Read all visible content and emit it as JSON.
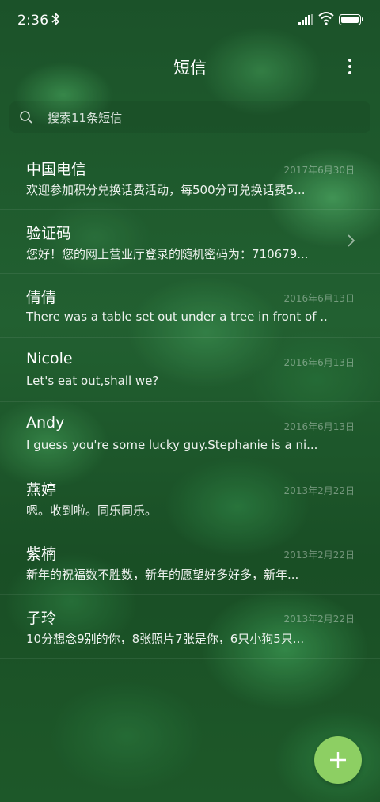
{
  "status": {
    "time": "2:36",
    "bluetooth_icon": "bluetooth-icon",
    "signal_icon": "signal-icon",
    "wifi_icon": "wifi-icon",
    "battery_icon": "battery-icon"
  },
  "header": {
    "title": "短信",
    "more_icon": "more-vert-icon"
  },
  "search": {
    "placeholder": "搜索11条短信",
    "icon": "search-icon"
  },
  "messages": [
    {
      "name": "中国电信",
      "date": "2017年6月30日",
      "preview": "欢迎参加积分兑换话费活动，每500分可兑换话费5..."
    },
    {
      "name": "验证码",
      "date": "",
      "preview": "您好！您的网上营业厅登录的随机密码为：710679...",
      "has_chevron": true
    },
    {
      "name": "倩倩",
      "date": "2016年6月13日",
      "preview": "There was a table set out under a tree in front of ..."
    },
    {
      "name": "Nicole",
      "date": "2016年6月13日",
      "preview": "Let's eat out,shall we?"
    },
    {
      "name": "Andy",
      "date": "2016年6月13日",
      "preview": "I guess you're some lucky guy.Stephanie is a ni..."
    },
    {
      "name": "燕婷",
      "date": "2013年2月22日",
      "preview": "嗯。收到啦。同乐同乐。"
    },
    {
      "name": "紫楠",
      "date": "2013年2月22日",
      "preview": "新年的祝福数不胜数，新年的愿望好多好多，新年..."
    },
    {
      "name": "子玲",
      "date": "2013年2月22日",
      "preview": "10分想念9别的你，8张照片7张是你，6只小狗5只..."
    }
  ],
  "fab": {
    "icon": "plus-icon",
    "color": "#8dcf63"
  }
}
